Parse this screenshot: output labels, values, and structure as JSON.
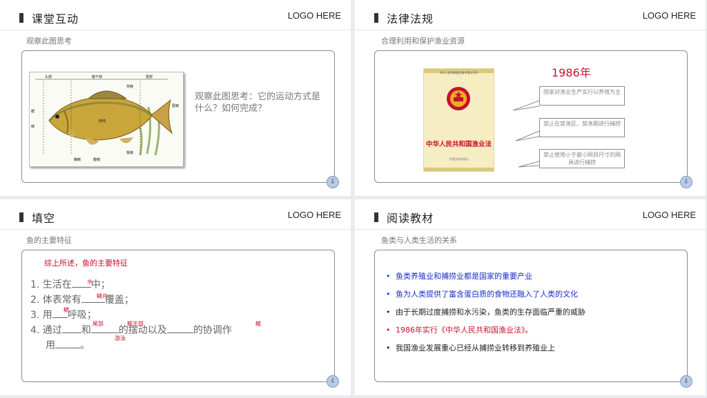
{
  "logo_text": "LOGO HERE",
  "slide1": {
    "title": "课堂互动",
    "subtitle": "观察此图思考",
    "question": "观察此图思考：它的运动方式是什么？如何完成？",
    "fish_labels": [
      "头部",
      "躯干部",
      "尾部",
      "鳃",
      "鳍",
      "侧线",
      "背鳍",
      "胸鳍",
      "腹鳍",
      "臀鳍",
      "尾鳍"
    ]
  },
  "slide2": {
    "title": "法律法规",
    "subtitle": "合理利用和保护渔业资源",
    "book_title": "中华人民共和国渔业法",
    "book_header": "中华人民共和国主席令第五号令",
    "book_publisher": "中国法制出版社",
    "year": "1986年",
    "callouts": [
      "国家对渔业生产实行以养殖为主",
      "禁止在禁渔区、禁渔期进行捕捞",
      "禁止使用小于最小网目尺寸的网具进行捕捞"
    ]
  },
  "slide3": {
    "title": "填空",
    "subtitle": "鱼的主要特征",
    "summary": "综上所述，鱼的主要特征",
    "items": {
      "i1_pre": "1. 生活在",
      "i1_post": "中；",
      "i2_pre": "2. 体表常有",
      "i2_post": "覆盖；",
      "i3_pre": "3. 用",
      "i3_post": "呼吸；",
      "i4_pre": "4. 通过",
      "i4_mid1": "和",
      "i4_mid2": "的摆动以及",
      "i4_post": "的协调作",
      "i4_line2": "用",
      "i4_end": "。"
    },
    "answers": {
      "a1": "水",
      "a2": "鳞片",
      "a3": "鳃",
      "a4a": "尾部",
      "a4b": "躯干部",
      "a4c": "鳍",
      "a4d": "游泳"
    }
  },
  "slide4": {
    "title": "阅读教材",
    "subtitle": "鱼类与人类生活的关系",
    "bullets": [
      {
        "text": "鱼类养殖业和捕捞业都是国家的重要产业",
        "color": "blue"
      },
      {
        "text": "鱼为人类提供了富含蛋白质的食物还融入了人类的文化",
        "color": "blue"
      },
      {
        "text": "由于长期过度捕捞和水污染，鱼类的生存面临严重的威胁",
        "color": "black"
      },
      {
        "text": "1986年实行《中华人民共和国渔业法》。",
        "color": "red"
      },
      {
        "text": "我国渔业发展重心已经从捕捞业转移到养殖业上",
        "color": "black"
      }
    ]
  },
  "colors": {
    "accent_red": "#c8102e",
    "bullet_blue": "#1a2cc8"
  }
}
